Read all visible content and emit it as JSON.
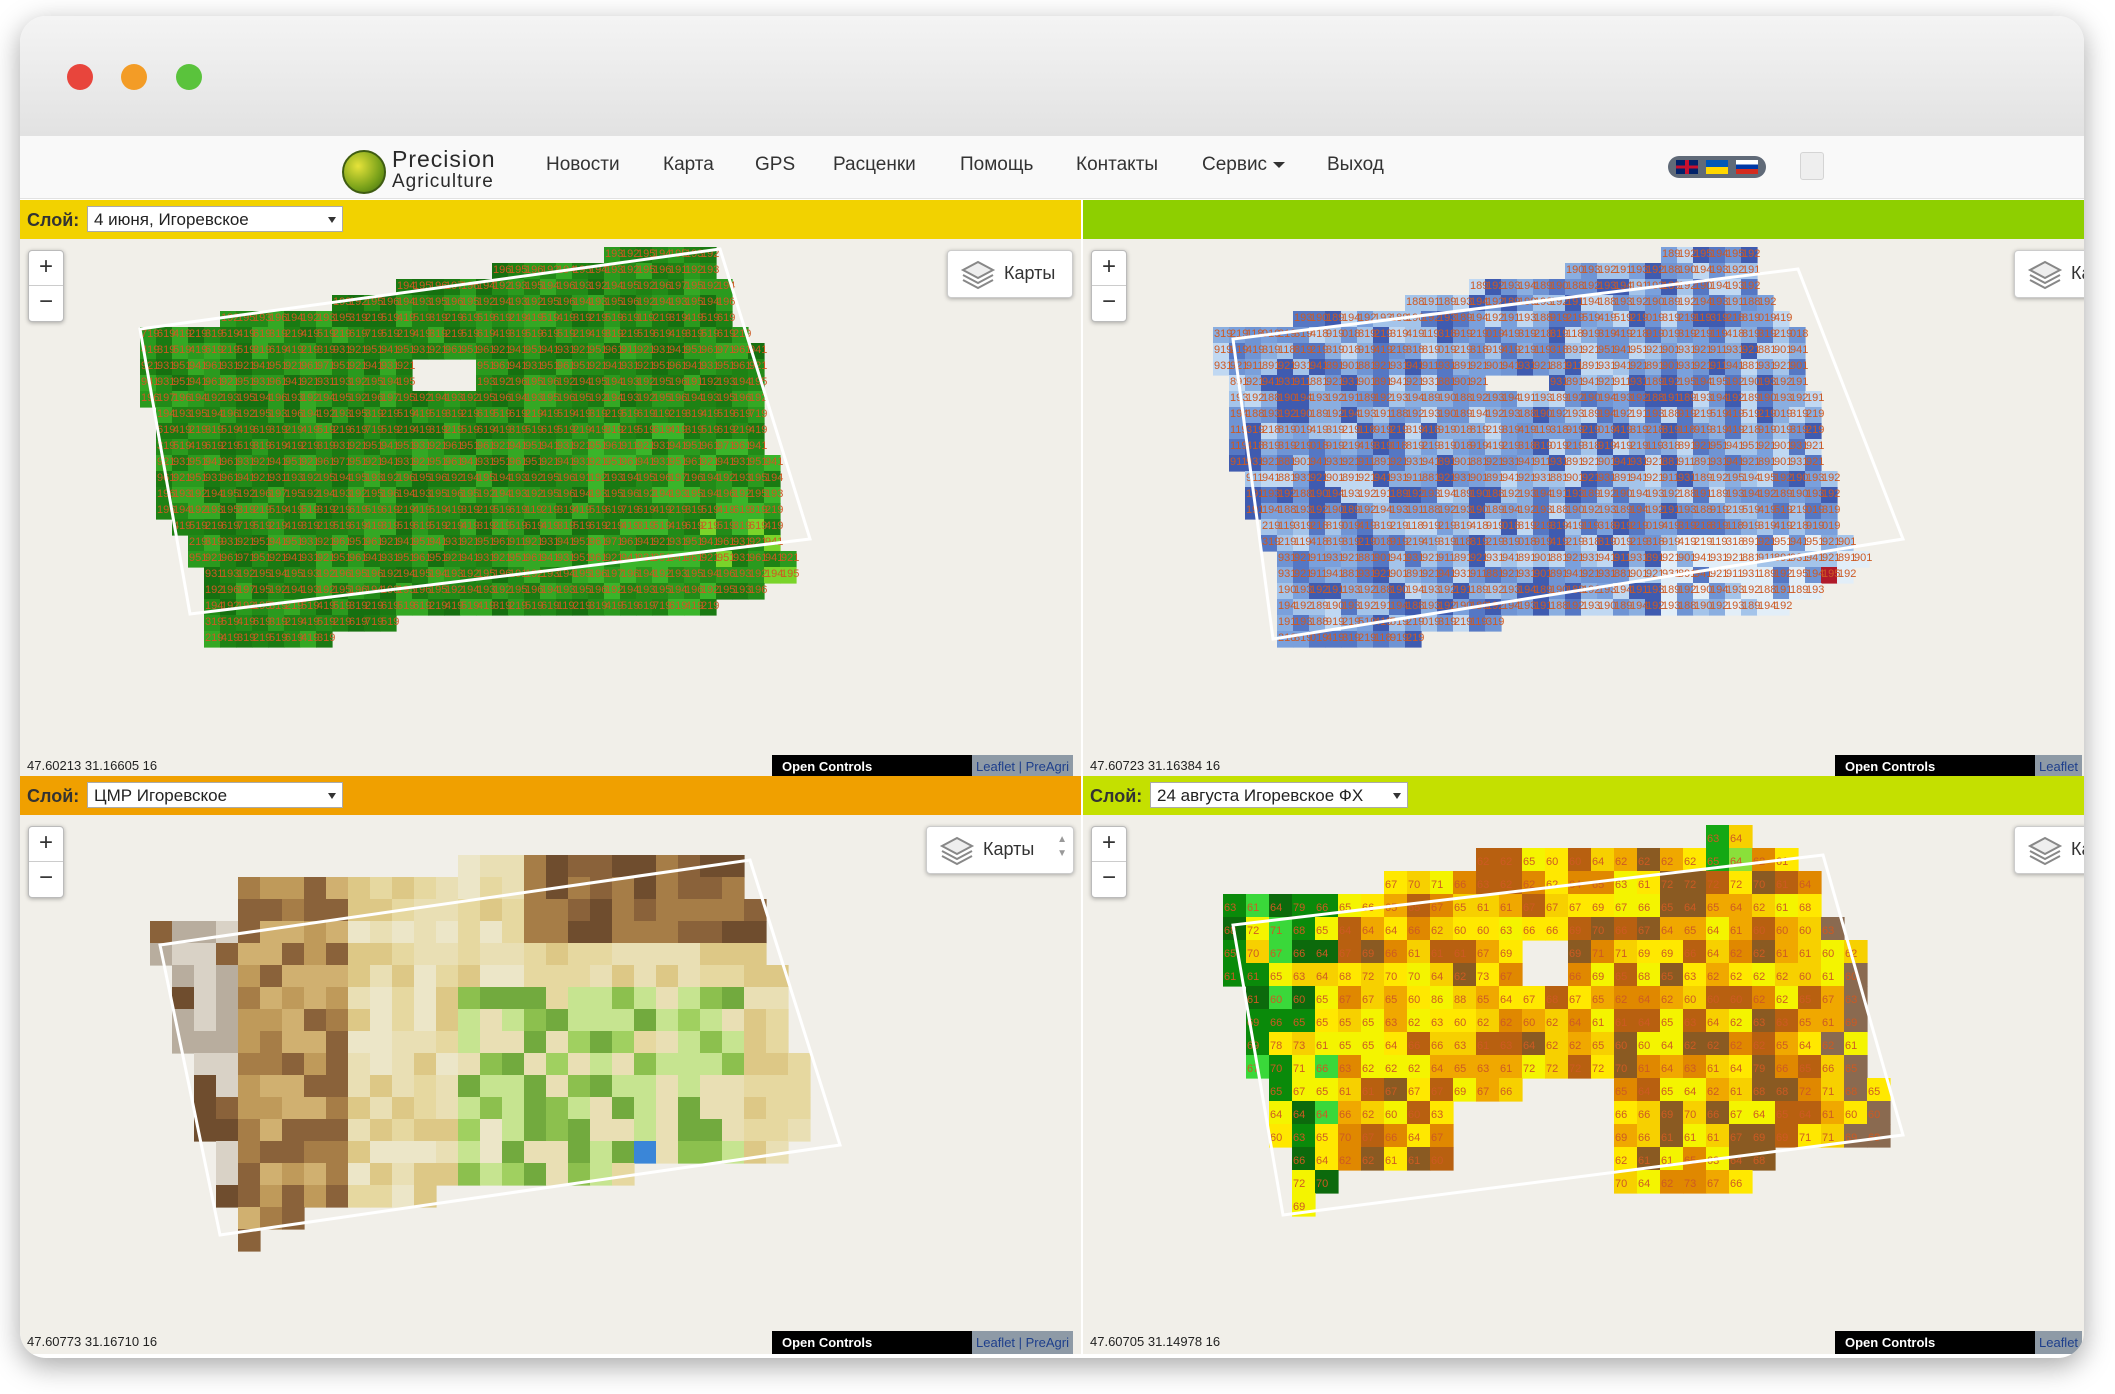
{
  "nav": {
    "logo_line1": "Precision",
    "logo_line2": "Agriculture",
    "items": [
      "Новости",
      "Карта",
      "GPS",
      "Расценки",
      "Помощь",
      "Контакты",
      "Сервис",
      "Выход"
    ]
  },
  "icons": {
    "window_close": "red-dot-icon",
    "window_minimize": "yellow-dot-icon",
    "window_maximize": "green-dot-icon",
    "logo": "leaf-logo-icon",
    "layers": "layers-icon",
    "flags": [
      "uk-flag-icon",
      "ua-flag-icon",
      "ru-flag-icon"
    ]
  },
  "colors": {
    "bar_yellow": "#f2d200",
    "bar_green": "#8ecf00",
    "bar_orange": "#f0a000",
    "bar_lime": "#c4e000",
    "label_text": "#cd5a23"
  },
  "panels": [
    {
      "layer_label": "Слой:",
      "layer_value": "4 июня, Игоревское",
      "maps_label": "Карты",
      "coords": "47.60213 31.16605 16",
      "controls": "Open Controls",
      "attribution": "Leaflet | PreAgri",
      "cell_text": "1931921951941951931921961951961921941951941931921951961911921931941951961971961941921931951941961931921941951921961971951921941931921951961941931951961951921941931921951961941931951961921941931951941961921951931961941921931951"
    },
    {
      "layer_label": "",
      "layer_value": "",
      "maps_label": "Ка",
      "coords": "47.60723 31.16384 16",
      "controls": "Open Controls",
      "attribution": "Leaflet",
      "cell_text": "1891921951941951921901931921911931921881901941931921911891921931941891901881921931941911931891921901941931921881911891931941921891901931921911941881931921901891921941931911881921931901891941921931881901921931891941921911931881"
    },
    {
      "layer_label": "Слой:",
      "layer_value": "ЦМР Игоревское",
      "maps_label": "Карты",
      "coords": "47.60773 31.16710 16",
      "controls": "Open Controls",
      "attribution": "Leaflet | PreAgri"
    },
    {
      "layer_label": "Слой:",
      "layer_value": "24 августа Игоревское ФХ",
      "maps_label": "Ка",
      "coords": "47.60705 31.14978 16",
      "controls": "Open Controls",
      "attribution": "Leaflet",
      "cell_values": [
        63,
        64,
        62,
        62,
        65,
        60,
        60,
        64,
        62,
        62,
        62,
        62,
        65,
        64,
        62,
        61,
        67,
        70,
        71,
        66,
        63,
        62,
        62,
        62,
        64,
        65,
        63,
        61,
        72,
        72,
        72,
        72,
        70,
        61,
        64,
        63,
        61,
        64,
        79,
        66,
        65,
        66,
        65,
        65,
        67,
        65,
        61,
        61,
        67,
        67,
        67,
        69,
        67,
        66,
        65,
        64,
        65,
        64,
        62,
        61,
        68,
        68,
        72,
        71,
        68,
        65,
        64,
        64,
        64,
        66,
        62,
        60,
        60,
        63,
        66,
        66,
        69,
        70,
        66,
        67,
        64,
        65,
        64,
        61,
        60,
        60,
        60,
        63,
        65,
        70,
        67,
        66,
        64,
        67,
        69,
        66,
        61,
        61,
        61,
        67,
        69,
        69,
        71,
        71,
        69,
        69,
        66,
        64,
        62,
        62,
        61,
        61,
        60,
        62,
        61,
        61,
        65,
        63,
        64,
        68,
        72,
        70,
        70,
        64,
        62,
        73,
        67,
        66,
        69,
        65,
        68,
        65,
        63,
        62,
        62,
        62,
        62,
        60,
        61,
        60,
        61,
        60,
        60,
        65,
        67,
        67,
        65,
        60,
        86,
        88,
        65,
        64,
        67,
        68,
        67,
        65,
        62,
        64,
        62,
        60,
        60,
        60,
        62,
        62,
        65,
        67,
        63,
        69,
        66,
        65,
        65,
        65,
        65,
        63,
        62,
        63,
        60,
        62,
        62,
        60,
        62,
        64,
        61,
        61,
        64,
        65,
        63,
        64,
        62,
        63,
        63,
        65,
        61,
        69,
        69,
        78,
        73,
        61,
        65,
        65,
        64,
        66,
        66,
        63,
        61
      ]
    }
  ]
}
